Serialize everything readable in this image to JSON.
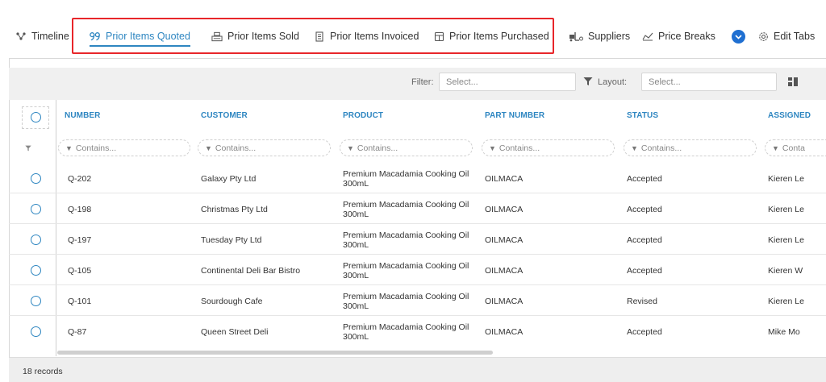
{
  "tabs": [
    {
      "label": "Timeline",
      "icon": "timeline-icon"
    },
    {
      "label": "Prior Items Quoted",
      "icon": "quote-icon",
      "active": true
    },
    {
      "label": "Prior Items Sold",
      "icon": "cash-register-icon"
    },
    {
      "label": "Prior Items Invoiced",
      "icon": "invoice-icon"
    },
    {
      "label": "Prior Items Purchased",
      "icon": "purchase-icon"
    },
    {
      "label": "Suppliers",
      "icon": "forklift-icon"
    },
    {
      "label": "Price Breaks",
      "icon": "chart-line-icon"
    }
  ],
  "edit_tabs_label": "Edit Tabs",
  "toolbar": {
    "filter_label": "Filter:",
    "filter_placeholder": "Select...",
    "layout_label": "Layout:",
    "layout_placeholder": "Select..."
  },
  "columns": [
    "NUMBER",
    "CUSTOMER",
    "PRODUCT",
    "PART NUMBER",
    "STATUS",
    "ASSIGNED"
  ],
  "filter_placeholders": [
    "Contains...",
    "Contains...",
    "Contains...",
    "Contains...",
    "Contains...",
    "Conta"
  ],
  "rows": [
    {
      "number": "Q-202",
      "customer": "Galaxy Pty Ltd",
      "product_line1": "Premium Macadamia Cooking Oil",
      "product_line2": "300mL",
      "part": "OILMACA",
      "status": "Accepted",
      "assigned": "Kieren Le"
    },
    {
      "number": "Q-198",
      "customer": "Christmas Pty Ltd",
      "product_line1": "Premium Macadamia Cooking Oil",
      "product_line2": "300mL",
      "part": "OILMACA",
      "status": "Accepted",
      "assigned": "Kieren Le"
    },
    {
      "number": "Q-197",
      "customer": "Tuesday Pty Ltd",
      "product_line1": "Premium Macadamia Cooking Oil",
      "product_line2": "300mL",
      "part": "OILMACA",
      "status": "Accepted",
      "assigned": "Kieren Le"
    },
    {
      "number": "Q-105",
      "customer": "Continental Deli Bar Bistro",
      "product_line1": "Premium Macadamia Cooking Oil",
      "product_line2": "300mL",
      "part": "OILMACA",
      "status": "Accepted",
      "assigned": "Kieren W"
    },
    {
      "number": "Q-101",
      "customer": "Sourdough Cafe",
      "product_line1": "Premium Macadamia Cooking Oil",
      "product_line2": "300mL",
      "part": "OILMACA",
      "status": "Revised",
      "assigned": "Kieren Le"
    },
    {
      "number": "Q-87",
      "customer": "Queen Street Deli",
      "product_line1": "Premium Macadamia Cooking Oil",
      "product_line2": "300mL",
      "part": "OILMACA",
      "status": "Accepted",
      "assigned": "Mike Mo"
    }
  ],
  "record_count": "18 records",
  "colors": {
    "accent": "#2e86c1",
    "highlight": "#e8262a",
    "toggle": "#1f6fd1"
  }
}
